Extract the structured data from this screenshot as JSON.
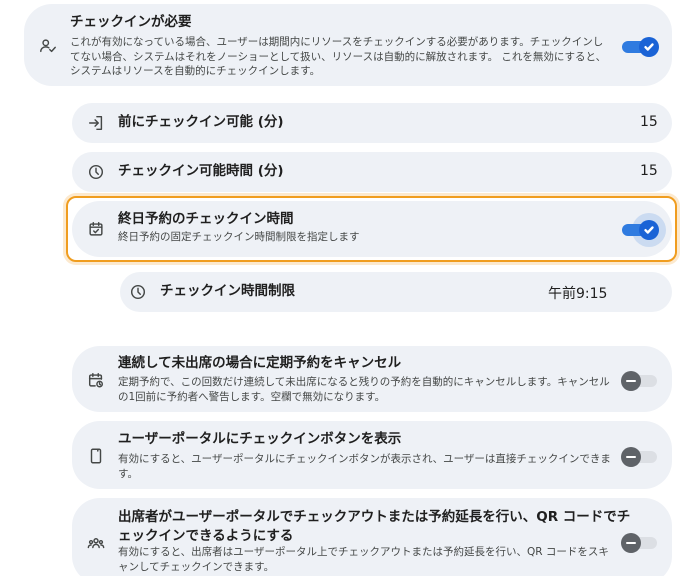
{
  "checkin_required": {
    "title": "チェックインが必要",
    "description": "これが有効になっている場合、ユーザーは期間内にリソースをチェックインする必要があります。チェックインしてない場合、システムはそれをノーショーとして扱い、リソースは自動的に解放されます。 これを無効にすると、システムはリソースを自動的にチェックインします。",
    "icon": "person-check-icon",
    "enabled": true
  },
  "checkin_before": {
    "label": "前にチェックイン可能 (分)",
    "value": "15",
    "icon": "login-icon"
  },
  "checkin_window": {
    "label": "チェックイン可能時間 (分)",
    "value": "15",
    "icon": "clock-icon"
  },
  "allday_checkin": {
    "title": "終日予約のチェックイン時間",
    "description": "終日予約の固定チェックイン時間制限を指定します",
    "icon": "calendar-check-icon",
    "enabled": true
  },
  "checkin_time_limit": {
    "label": "チェックイン時間制限",
    "value": "午前9:15",
    "icon": "clock-icon"
  },
  "cancel_recurring": {
    "title": "連続して未出席の場合に定期予約をキャンセル",
    "description": "定期予約で、この回数だけ連続して未出席になると残りの予約を自動的にキャンセルします。キャンセルの1回前に予約者へ警告します。空欄で無効になります。",
    "icon": "calendar-repeat-icon",
    "enabled": false
  },
  "portal_checkin_button": {
    "title": "ユーザーポータルにチェックインボタンを表示",
    "description": "有効にすると、ユーザーポータルにチェックインボタンが表示され、ユーザーは直接チェックインできます。",
    "icon": "mobile-icon",
    "enabled": false
  },
  "attendee_checkout": {
    "title": "出席者がユーザーポータルでチェックアウトまたは予約延長を行い、QR コードでチェックインできるようにする",
    "description": "有効にすると、出席者はユーザーポータル上でチェックアウトまたは予約延長を行い、QR コードをスキャンしてチェックインできます。",
    "icon": "group-icon",
    "enabled": false
  },
  "colors": {
    "accent": "#1a63d6",
    "card": "#eef1f6",
    "focus": "#f09d1f"
  }
}
